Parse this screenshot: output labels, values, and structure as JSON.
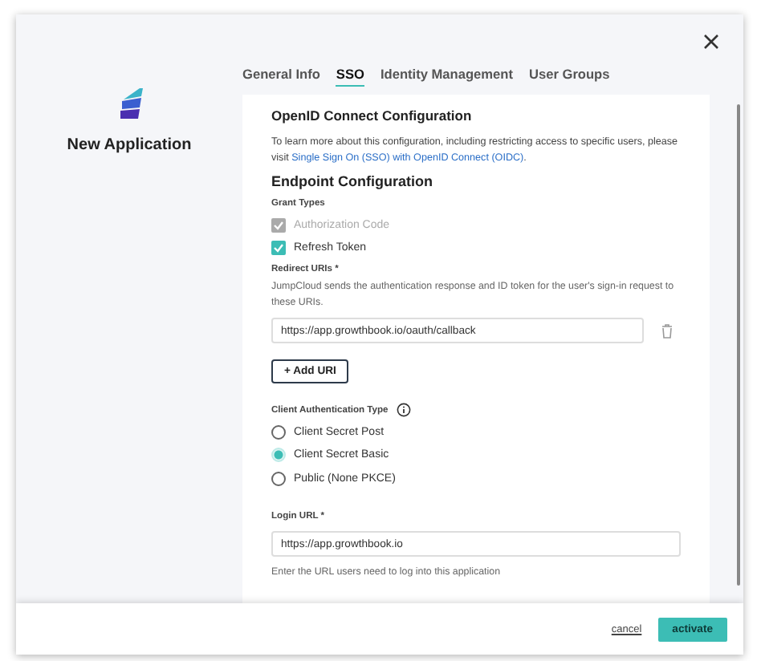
{
  "app": {
    "title": "New Application"
  },
  "tabs": [
    {
      "label": "General Info",
      "selected": false
    },
    {
      "label": "SSO",
      "selected": true
    },
    {
      "label": "Identity Management",
      "selected": false
    },
    {
      "label": "User Groups",
      "selected": false
    }
  ],
  "section_title": "OpenID Connect Configuration",
  "intro": "To learn more about this configuration, including restricting access to specific users, please visit ",
  "intro_link": "Single Sign On (SSO) with OpenID Connect (OIDC)",
  "intro_end": ".",
  "endpoint_title": "Endpoint Configuration",
  "grant_types": {
    "label": "Grant Types",
    "options": [
      {
        "label": "Authorization Code",
        "checked": true,
        "disabled": true
      },
      {
        "label": "Refresh Token",
        "checked": true,
        "disabled": false
      }
    ]
  },
  "redirect_uris": {
    "label": "Redirect URIs *",
    "help": "JumpCloud sends the authentication response and ID token for the user's sign-in request to these URIs.",
    "values": [
      "https://app.growthbook.io/oauth/callback"
    ],
    "add_button": "+ Add URI"
  },
  "client_auth": {
    "label": "Client Authentication Type",
    "options": [
      {
        "label": "Client Secret Post",
        "selected": false
      },
      {
        "label": "Client Secret Basic",
        "selected": true
      },
      {
        "label": "Public (None PKCE)",
        "selected": false
      }
    ]
  },
  "login_url": {
    "label": "Login URL *",
    "value": "https://app.growthbook.io",
    "help": "Enter the URL users need to log into this application"
  },
  "footer": {
    "cancel": "cancel",
    "activate": "activate"
  }
}
